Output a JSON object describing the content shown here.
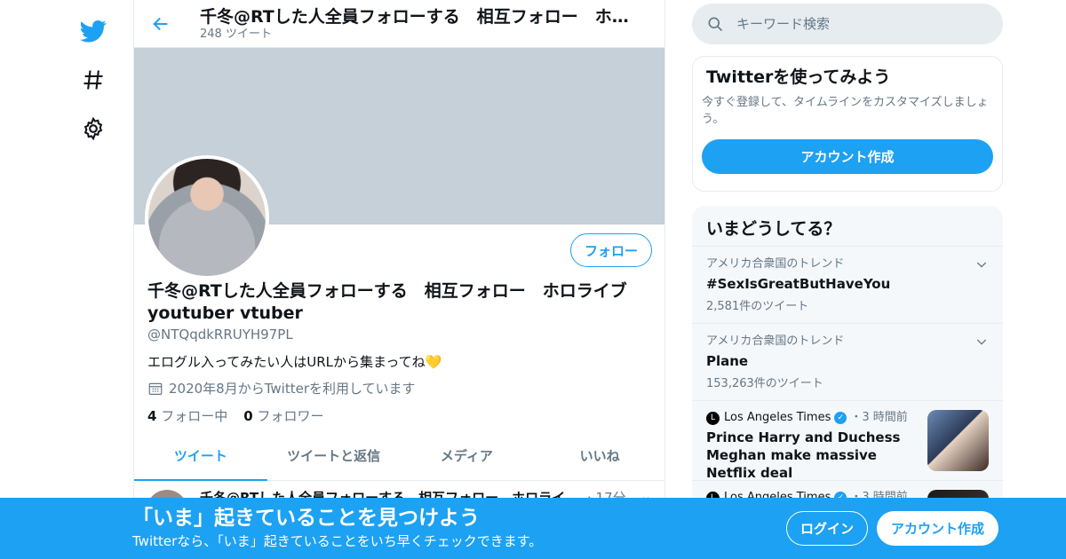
{
  "header": {
    "name": "千冬@RTした人全員フォローする　相互フォロー　ホロライブ youtuber vtuber",
    "tweet_count": "248 ツイート"
  },
  "profile": {
    "display_name": "千冬@RTした人全員フォローする　相互フォロー　ホロライブ youtuber vtuber",
    "handle": "@NTQqdkRRUYH97PL",
    "bio": "エログル入ってみたい人はURLから集まってね",
    "bio_emoji": "💛",
    "joined": "2020年8月からTwitterを利用しています",
    "following_count": "4",
    "following_label": "フォロー中",
    "followers_count": "0",
    "followers_label": "フォロワー",
    "follow_button": "フォロー"
  },
  "tabs": [
    {
      "label": "ツイート",
      "active": true
    },
    {
      "label": "ツイートと返信",
      "active": false
    },
    {
      "label": "メディア",
      "active": false
    },
    {
      "label": "いいね",
      "active": false
    }
  ],
  "tweet_peek": {
    "name": "千冬@RTした人全員フォローする　相互フォロー　ホロライ",
    "time": "· 17分",
    "caret": "⌄"
  },
  "search": {
    "placeholder": "キーワード検索"
  },
  "signup_card": {
    "title": "Twitterを使ってみよう",
    "subtitle": "今すぐ登録して、タイムラインをカスタマイズしましょう。",
    "button": "アカウント作成"
  },
  "trends": {
    "title": "いまどうしてる？",
    "items": [
      {
        "meta": "アメリカ合衆国のトレンド",
        "name": "#SexIsGreatButHaveYou",
        "count": "2,581件のツイート"
      },
      {
        "meta": "アメリカ合衆国のトレンド",
        "name": "Plane",
        "count": "153,263件のツイート"
      }
    ],
    "news": [
      {
        "source": "Los Angeles Times",
        "time": "・3 時間前",
        "headline": "Prince Harry and Duchess Meghan make massive Netflix deal"
      },
      {
        "source": "Los Angeles Times",
        "time": "・3 時間前",
        "headline": ""
      }
    ]
  },
  "bottom_bar": {
    "title": "「いま」起きていることを見つけよう",
    "subtitle": "Twitterなら、「いま」起きていることをいち早くチェックできます。",
    "login": "ログイン",
    "signup": "アカウント作成"
  },
  "colors": {
    "accent": "#1da1f2",
    "banner": "#c5d0d8",
    "muted": "#657786"
  }
}
